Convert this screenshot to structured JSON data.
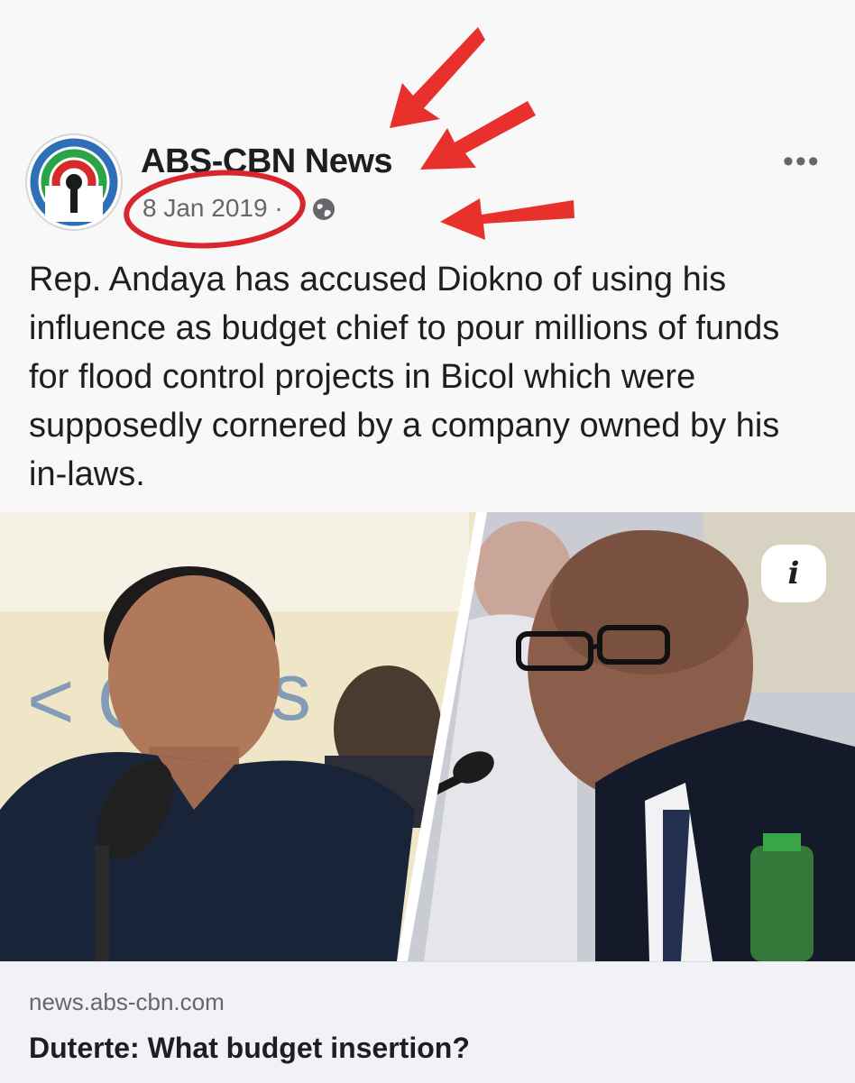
{
  "post": {
    "page_name": "ABS-CBN News",
    "date": "8 Jan 2019 ·",
    "more_icon": "•••",
    "caption": "Rep. Andaya has accused Diokno of using his influence as budget chief to pour millions of funds for flood control projects in Bicol which were supposedly cornered by a company owned by his in-laws.",
    "info_icon": "i"
  },
  "link_preview": {
    "domain": "news.abs-cbn.com",
    "headline": "Duterte: What budget insertion?"
  },
  "annotations": {
    "arrow_color": "#e8302c",
    "circle_color": "#d9262c"
  }
}
